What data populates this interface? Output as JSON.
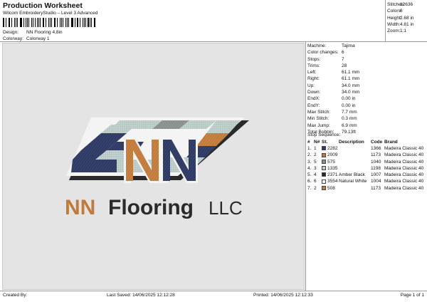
{
  "header": {
    "title": "Production Worksheet",
    "subtitle": "Wilcom EmbroideryStudio – Level 3 Advanced",
    "design_label": "Design:",
    "design_value": "NN Flooring 4,8in",
    "colorway_label": "Colorway:",
    "colorway_value": "Colorway 1"
  },
  "summary": [
    {
      "label": "Stitches:",
      "value": "12636"
    },
    {
      "label": "Colors:",
      "value": "6"
    },
    {
      "label": "Height:",
      "value": "2.68 in"
    },
    {
      "label": "Width:",
      "value": "4.81 in"
    },
    {
      "label": "Zoom:",
      "value": "1:1"
    }
  ],
  "machine_info": [
    {
      "label": "Machine:",
      "value": "Tajima"
    },
    {
      "label": "Color changes:",
      "value": "6"
    },
    {
      "label": "Stops:",
      "value": "7"
    },
    {
      "label": "Trims:",
      "value": "28"
    },
    {
      "label": "Left:",
      "value": "61.1 mm"
    },
    {
      "label": "Right:",
      "value": "61.1 mm"
    },
    {
      "label": "Up:",
      "value": "34.0 mm"
    },
    {
      "label": "Down:",
      "value": "34.0 mm"
    },
    {
      "label": "EndX:",
      "value": "0.00 in"
    },
    {
      "label": "EndY:",
      "value": "0.00 in"
    },
    {
      "label": "Max Stitch:",
      "value": "7.7 mm"
    },
    {
      "label": "Min Stitch:",
      "value": "0.3 mm"
    },
    {
      "label": "Max Jump:",
      "value": "6.9 mm"
    },
    {
      "label": "Total Bobbin:",
      "value": "79.13ft"
    }
  ],
  "stop_sequence": {
    "title": "Stop Sequence:",
    "headers": [
      "#",
      "N#",
      "St.",
      "Description",
      "Code",
      "Brand"
    ],
    "rows": [
      {
        "num": "1.",
        "n": "1",
        "color": "#2f3a63",
        "st": "2282",
        "desc": "",
        "code": "1366",
        "brand": "Madeira Classic 40"
      },
      {
        "num": "2.",
        "n": "2",
        "color": "#c07a3c",
        "st": "2009",
        "desc": "",
        "code": "1173",
        "brand": "Madeira Classic 40"
      },
      {
        "num": "3.",
        "n": "5",
        "color": "#8a8f8c",
        "st": "575",
        "desc": "",
        "code": "1040",
        "brand": "Madeira Classic 40"
      },
      {
        "num": "4.",
        "n": "3",
        "color": "#b9c9c6",
        "st": "1335",
        "desc": "",
        "code": "1198",
        "brand": "Madeira Classic 40"
      },
      {
        "num": "5.",
        "n": "4",
        "color": "#2a2a2a",
        "st": "2371",
        "desc": "Amber Black",
        "code": "1007",
        "brand": "Madeira Classic 40"
      },
      {
        "num": "6.",
        "n": "6",
        "color": "#f4f4f4",
        "st": "3554",
        "desc": "Natural White",
        "code": "1004",
        "brand": "Madeira Classic 40"
      },
      {
        "num": "7.",
        "n": "2",
        "color": "#c07a3c",
        "st": "508",
        "desc": "",
        "code": "1173",
        "brand": "Madeira Classic 40"
      }
    ]
  },
  "logo": {
    "monogram": "NN",
    "word_brand": "NN",
    "word_main": "Flooring",
    "word_suffix": "LLC",
    "colors": {
      "navy": "#2f3a63",
      "orange": "#c07a3c",
      "gray": "#8a8f8c",
      "light": "#b9c9c6",
      "black": "#2a2a2a",
      "white": "#f4f4f4"
    }
  },
  "footer": {
    "created": "Created By:",
    "saved": "Last Saved: 14/06/2025 12:12:28",
    "printed": "Printed: 14/06/2025 12:12:33",
    "page": "Page 1 of 1"
  }
}
